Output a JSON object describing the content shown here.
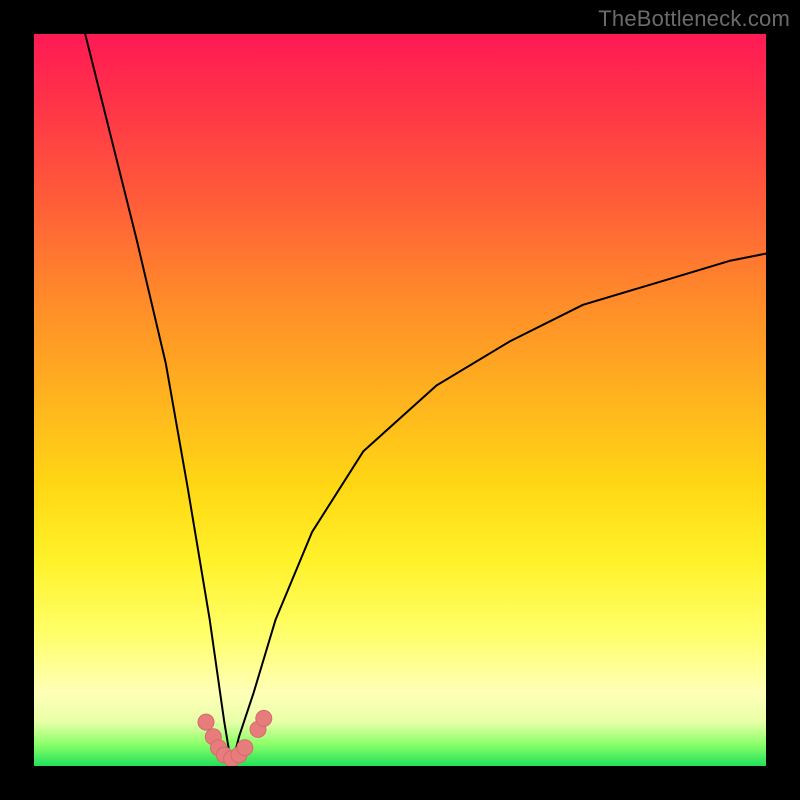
{
  "watermark": "TheBottleneck.com",
  "colors": {
    "page_bg": "#000000",
    "curve_stroke": "#000000",
    "marker_fill": "#e77c7c",
    "marker_stroke": "#d66a6a"
  },
  "chart_data": {
    "type": "line",
    "title": "",
    "xlabel": "",
    "ylabel": "",
    "xlim": [
      0,
      100
    ],
    "ylim": [
      0,
      100
    ],
    "grid": false,
    "legend": false,
    "note": "Values estimated from pixels; axes unlabeled in source. Curve minimum near x≈27, y≈0. Second branch rises toward x=100, y≈70.",
    "series": [
      {
        "name": "curve",
        "x": [
          7,
          10,
          14,
          18,
          21,
          24,
          26,
          27,
          28,
          30,
          33,
          38,
          45,
          55,
          65,
          75,
          85,
          95,
          100
        ],
        "y": [
          100,
          88,
          72,
          55,
          38,
          20,
          6,
          0,
          4,
          10,
          20,
          32,
          43,
          52,
          58,
          63,
          66,
          69,
          70
        ]
      }
    ],
    "markers": {
      "name": "bottom-cluster",
      "x": [
        23.5,
        24.5,
        25.2,
        26.0,
        27.0,
        28.0,
        28.8,
        30.6,
        31.4
      ],
      "y": [
        6.0,
        4.0,
        2.5,
        1.5,
        1.0,
        1.5,
        2.5,
        5.0,
        6.5
      ]
    }
  }
}
